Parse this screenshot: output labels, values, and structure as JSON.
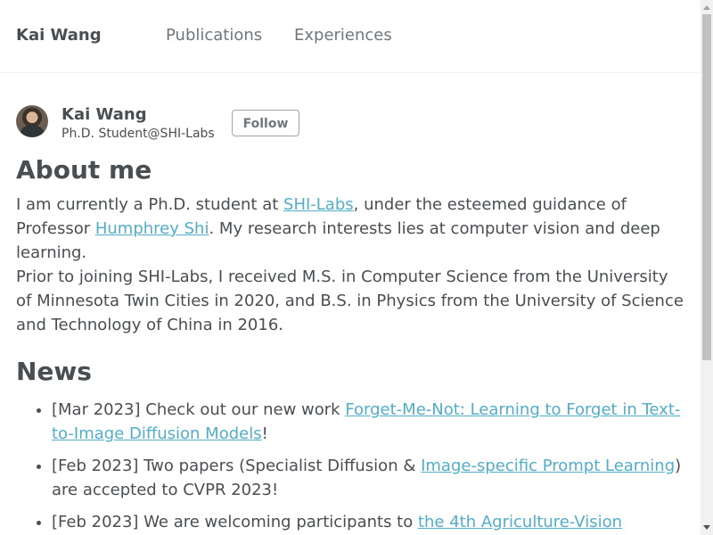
{
  "header": {
    "site_title": "Kai Wang",
    "nav": [
      "Publications",
      "Experiences"
    ]
  },
  "author": {
    "name": "Kai Wang",
    "bio": "Ph.D. Student@SHI-Labs",
    "follow_label": "Follow"
  },
  "about": {
    "heading": "About me",
    "p1_a": "I am currently a Ph.D. student at ",
    "p1_link1": "SHI-Labs",
    "p1_b": ", under the esteemed guidance of Professor ",
    "p1_link2": "Humphrey Shi",
    "p1_c": ". My research interests lies at computer vision and deep learning.",
    "p2": "Prior to joining SHI-Labs, I received M.S. in Computer Science from the University of Minnesota Twin Cities in 2020, and B.S. in Physics from the University of Science and Technology of China in 2016."
  },
  "news": {
    "heading": "News",
    "items": [
      {
        "pre": "[Mar 2023] Check out our new work ",
        "link": "Forget-Me-Not: Learning to Forget in Text-to-Image Diffusion Models",
        "post": "!"
      },
      {
        "pre": "[Feb 2023] Two papers (Specialist Diffusion & ",
        "link": "Image-specific Prompt Learning",
        "post": ") are accepted to CVPR 2023!"
      },
      {
        "pre": "[Feb 2023] We are welcoming participants to ",
        "link": "the 4th Agriculture-Vision",
        "post": ""
      }
    ]
  }
}
